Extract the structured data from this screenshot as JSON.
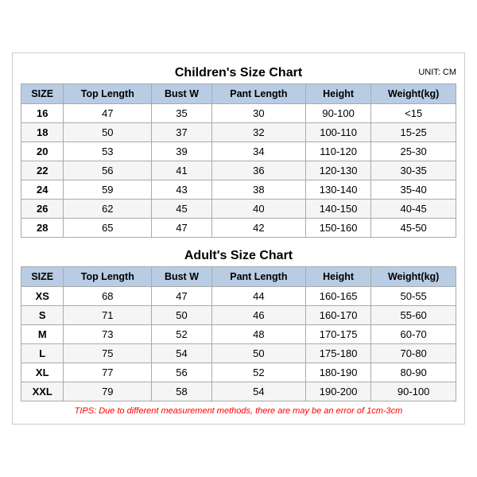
{
  "children_title": "Children's Size Chart",
  "adult_title": "Adult's Size Chart",
  "unit_label": "UNIT: CM",
  "tips": "TIPS: Due to different measurement methods, there are may be an error of 1cm-3cm",
  "headers": [
    "SIZE",
    "Top Length",
    "Bust W",
    "Pant Length",
    "Height",
    "Weight(kg)"
  ],
  "children_rows": [
    [
      "16",
      "47",
      "35",
      "30",
      "90-100",
      "<15"
    ],
    [
      "18",
      "50",
      "37",
      "32",
      "100-110",
      "15-25"
    ],
    [
      "20",
      "53",
      "39",
      "34",
      "110-120",
      "25-30"
    ],
    [
      "22",
      "56",
      "41",
      "36",
      "120-130",
      "30-35"
    ],
    [
      "24",
      "59",
      "43",
      "38",
      "130-140",
      "35-40"
    ],
    [
      "26",
      "62",
      "45",
      "40",
      "140-150",
      "40-45"
    ],
    [
      "28",
      "65",
      "47",
      "42",
      "150-160",
      "45-50"
    ]
  ],
  "adult_rows": [
    [
      "XS",
      "68",
      "47",
      "44",
      "160-165",
      "50-55"
    ],
    [
      "S",
      "71",
      "50",
      "46",
      "160-170",
      "55-60"
    ],
    [
      "M",
      "73",
      "52",
      "48",
      "170-175",
      "60-70"
    ],
    [
      "L",
      "75",
      "54",
      "50",
      "175-180",
      "70-80"
    ],
    [
      "XL",
      "77",
      "56",
      "52",
      "180-190",
      "80-90"
    ],
    [
      "XXL",
      "79",
      "58",
      "54",
      "190-200",
      "90-100"
    ]
  ]
}
